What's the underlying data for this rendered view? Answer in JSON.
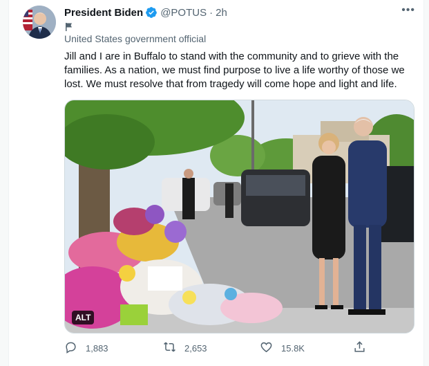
{
  "tweet": {
    "author_name": "President Biden",
    "handle": "@POTUS",
    "separator": "·",
    "time": "2h",
    "more_label": "•••",
    "account_label": "United States government official",
    "text": "Jill and I are in Buffalo to stand with the community and to grieve with the families. As a nation, we must find purpose to live a life worthy of those we lost. We must resolve that from tragedy will come hope and light and life.",
    "media_alt_badge": "ALT",
    "replies": "1,883",
    "retweets": "2,653",
    "likes": "15.8K"
  },
  "colors": {
    "verified": "#1d9bf0",
    "muted_text": "#536471",
    "text": "#0f1419"
  },
  "icons": [
    "verified-badge-icon",
    "more-icon",
    "flag-icon",
    "reply-icon",
    "retweet-icon",
    "like-icon",
    "share-icon"
  ]
}
